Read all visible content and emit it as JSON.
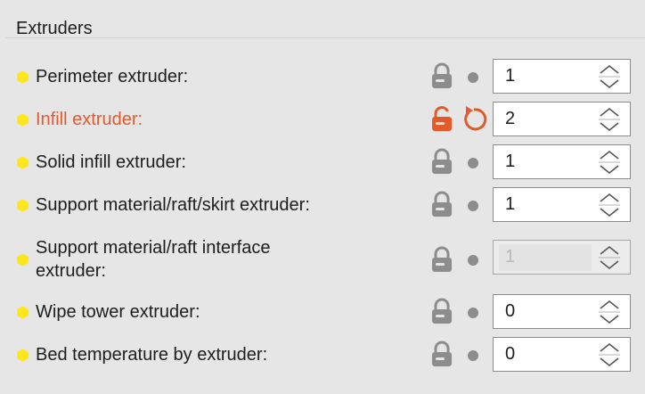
{
  "section": {
    "title": "Extruders"
  },
  "colors": {
    "bullet": "#ffe61a",
    "modified_label": "#e5592a",
    "icon_gray": "#8d8d8d"
  },
  "rows": [
    {
      "label": "Perimeter extruder:",
      "value": "1",
      "modified": false,
      "disabled": false
    },
    {
      "label": "Infill extruder:",
      "value": "2",
      "modified": true,
      "disabled": false
    },
    {
      "label": "Solid infill extruder:",
      "value": "1",
      "modified": false,
      "disabled": false
    },
    {
      "label": "Support material/raft/skirt extruder:",
      "value": "1",
      "modified": false,
      "disabled": false
    },
    {
      "label_line1": "Support material/raft interface",
      "label_line2": "extruder:",
      "value": "1",
      "modified": false,
      "disabled": true
    },
    {
      "label": "Wipe tower extruder:",
      "value": "0",
      "modified": false,
      "disabled": false
    },
    {
      "label": "Bed temperature by extruder:",
      "value": "0",
      "modified": false,
      "disabled": false
    }
  ],
  "icons": {
    "bullet": "hexagon-bullet-icon",
    "locked": "lock-icon",
    "unlocked": "unlock-icon",
    "dot": "system-value-dot-icon",
    "undo": "undo-arrow-icon",
    "spin": "spin-arrows-icon"
  }
}
